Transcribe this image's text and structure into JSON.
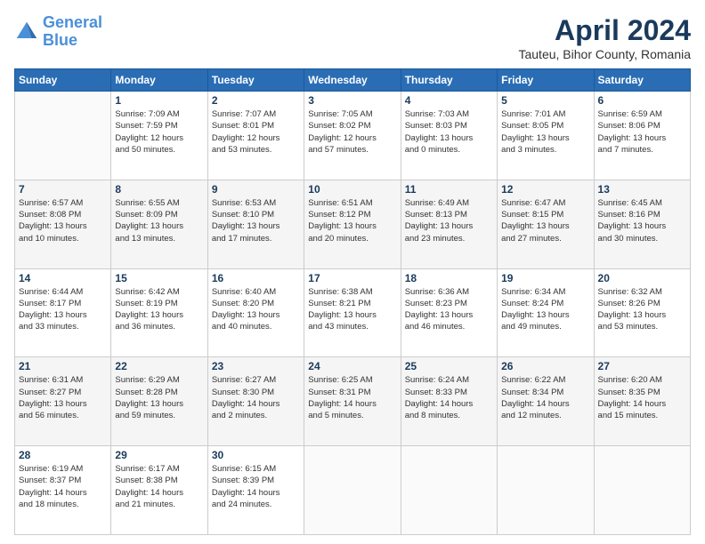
{
  "logo": {
    "line1": "General",
    "line2": "Blue"
  },
  "title": "April 2024",
  "location": "Tauteu, Bihor County, Romania",
  "days_header": [
    "Sunday",
    "Monday",
    "Tuesday",
    "Wednesday",
    "Thursday",
    "Friday",
    "Saturday"
  ],
  "weeks": [
    [
      {
        "day": "",
        "text": ""
      },
      {
        "day": "1",
        "text": "Sunrise: 7:09 AM\nSunset: 7:59 PM\nDaylight: 12 hours\nand 50 minutes."
      },
      {
        "day": "2",
        "text": "Sunrise: 7:07 AM\nSunset: 8:01 PM\nDaylight: 12 hours\nand 53 minutes."
      },
      {
        "day": "3",
        "text": "Sunrise: 7:05 AM\nSunset: 8:02 PM\nDaylight: 12 hours\nand 57 minutes."
      },
      {
        "day": "4",
        "text": "Sunrise: 7:03 AM\nSunset: 8:03 PM\nDaylight: 13 hours\nand 0 minutes."
      },
      {
        "day": "5",
        "text": "Sunrise: 7:01 AM\nSunset: 8:05 PM\nDaylight: 13 hours\nand 3 minutes."
      },
      {
        "day": "6",
        "text": "Sunrise: 6:59 AM\nSunset: 8:06 PM\nDaylight: 13 hours\nand 7 minutes."
      }
    ],
    [
      {
        "day": "7",
        "text": "Sunrise: 6:57 AM\nSunset: 8:08 PM\nDaylight: 13 hours\nand 10 minutes."
      },
      {
        "day": "8",
        "text": "Sunrise: 6:55 AM\nSunset: 8:09 PM\nDaylight: 13 hours\nand 13 minutes."
      },
      {
        "day": "9",
        "text": "Sunrise: 6:53 AM\nSunset: 8:10 PM\nDaylight: 13 hours\nand 17 minutes."
      },
      {
        "day": "10",
        "text": "Sunrise: 6:51 AM\nSunset: 8:12 PM\nDaylight: 13 hours\nand 20 minutes."
      },
      {
        "day": "11",
        "text": "Sunrise: 6:49 AM\nSunset: 8:13 PM\nDaylight: 13 hours\nand 23 minutes."
      },
      {
        "day": "12",
        "text": "Sunrise: 6:47 AM\nSunset: 8:15 PM\nDaylight: 13 hours\nand 27 minutes."
      },
      {
        "day": "13",
        "text": "Sunrise: 6:45 AM\nSunset: 8:16 PM\nDaylight: 13 hours\nand 30 minutes."
      }
    ],
    [
      {
        "day": "14",
        "text": "Sunrise: 6:44 AM\nSunset: 8:17 PM\nDaylight: 13 hours\nand 33 minutes."
      },
      {
        "day": "15",
        "text": "Sunrise: 6:42 AM\nSunset: 8:19 PM\nDaylight: 13 hours\nand 36 minutes."
      },
      {
        "day": "16",
        "text": "Sunrise: 6:40 AM\nSunset: 8:20 PM\nDaylight: 13 hours\nand 40 minutes."
      },
      {
        "day": "17",
        "text": "Sunrise: 6:38 AM\nSunset: 8:21 PM\nDaylight: 13 hours\nand 43 minutes."
      },
      {
        "day": "18",
        "text": "Sunrise: 6:36 AM\nSunset: 8:23 PM\nDaylight: 13 hours\nand 46 minutes."
      },
      {
        "day": "19",
        "text": "Sunrise: 6:34 AM\nSunset: 8:24 PM\nDaylight: 13 hours\nand 49 minutes."
      },
      {
        "day": "20",
        "text": "Sunrise: 6:32 AM\nSunset: 8:26 PM\nDaylight: 13 hours\nand 53 minutes."
      }
    ],
    [
      {
        "day": "21",
        "text": "Sunrise: 6:31 AM\nSunset: 8:27 PM\nDaylight: 13 hours\nand 56 minutes."
      },
      {
        "day": "22",
        "text": "Sunrise: 6:29 AM\nSunset: 8:28 PM\nDaylight: 13 hours\nand 59 minutes."
      },
      {
        "day": "23",
        "text": "Sunrise: 6:27 AM\nSunset: 8:30 PM\nDaylight: 14 hours\nand 2 minutes."
      },
      {
        "day": "24",
        "text": "Sunrise: 6:25 AM\nSunset: 8:31 PM\nDaylight: 14 hours\nand 5 minutes."
      },
      {
        "day": "25",
        "text": "Sunrise: 6:24 AM\nSunset: 8:33 PM\nDaylight: 14 hours\nand 8 minutes."
      },
      {
        "day": "26",
        "text": "Sunrise: 6:22 AM\nSunset: 8:34 PM\nDaylight: 14 hours\nand 12 minutes."
      },
      {
        "day": "27",
        "text": "Sunrise: 6:20 AM\nSunset: 8:35 PM\nDaylight: 14 hours\nand 15 minutes."
      }
    ],
    [
      {
        "day": "28",
        "text": "Sunrise: 6:19 AM\nSunset: 8:37 PM\nDaylight: 14 hours\nand 18 minutes."
      },
      {
        "day": "29",
        "text": "Sunrise: 6:17 AM\nSunset: 8:38 PM\nDaylight: 14 hours\nand 21 minutes."
      },
      {
        "day": "30",
        "text": "Sunrise: 6:15 AM\nSunset: 8:39 PM\nDaylight: 14 hours\nand 24 minutes."
      },
      {
        "day": "",
        "text": ""
      },
      {
        "day": "",
        "text": ""
      },
      {
        "day": "",
        "text": ""
      },
      {
        "day": "",
        "text": ""
      }
    ]
  ]
}
